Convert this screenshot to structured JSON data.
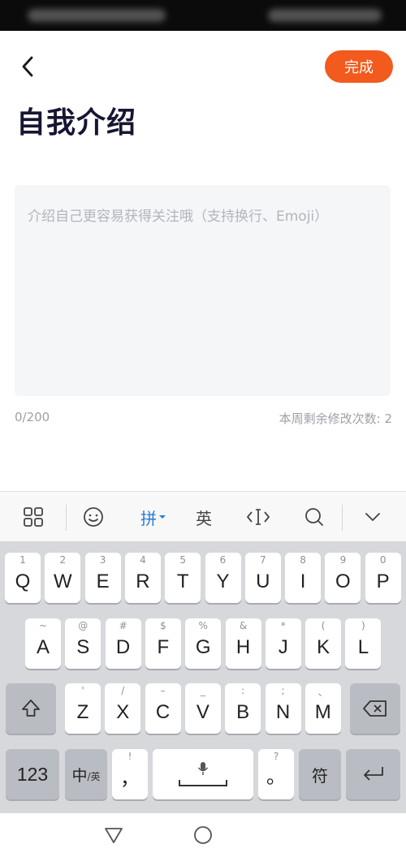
{
  "header": {
    "done_label": "完成",
    "title": "自我介绍"
  },
  "bio": {
    "placeholder": "介绍自己更容易获得关注哦（支持换行、Emoji）",
    "counter": "0/200",
    "remaining_edits": "本周剩余修改次数: 2"
  },
  "ime_toolbar": {
    "pinyin_label": "拼",
    "english_label": "英"
  },
  "keyboard": {
    "row1": [
      {
        "sub": "1",
        "main": "Q"
      },
      {
        "sub": "2",
        "main": "W"
      },
      {
        "sub": "3",
        "main": "E"
      },
      {
        "sub": "4",
        "main": "R"
      },
      {
        "sub": "5",
        "main": "T"
      },
      {
        "sub": "6",
        "main": "Y"
      },
      {
        "sub": "7",
        "main": "U"
      },
      {
        "sub": "8",
        "main": "I"
      },
      {
        "sub": "9",
        "main": "O"
      },
      {
        "sub": "0",
        "main": "P"
      }
    ],
    "row2": [
      {
        "sub": "~",
        "main": "A"
      },
      {
        "sub": "@",
        "main": "S"
      },
      {
        "sub": "#",
        "main": "D"
      },
      {
        "sub": "$",
        "main": "F"
      },
      {
        "sub": "%",
        "main": "G"
      },
      {
        "sub": "&",
        "main": "H"
      },
      {
        "sub": "*",
        "main": "J"
      },
      {
        "sub": "(",
        "main": "K"
      },
      {
        "sub": ")",
        "main": "L"
      }
    ],
    "row3": [
      {
        "sub": "'",
        "main": "Z"
      },
      {
        "sub": "/",
        "main": "X"
      },
      {
        "sub": "–",
        "main": "C"
      },
      {
        "sub": "_",
        "main": "V"
      },
      {
        "sub": ":",
        "main": "B"
      },
      {
        "sub": ";",
        "main": "N"
      },
      {
        "sub": "、",
        "main": "M"
      }
    ],
    "num_label": "123",
    "lang_zh": "中",
    "lang_en": "/英",
    "comma_sub": "!",
    "comma_main": "，",
    "period_sub": "?",
    "period_main": "。",
    "symbol_label": "符"
  },
  "colors": {
    "accent": "#f25a1e",
    "ime_active": "#2a7bd6"
  }
}
